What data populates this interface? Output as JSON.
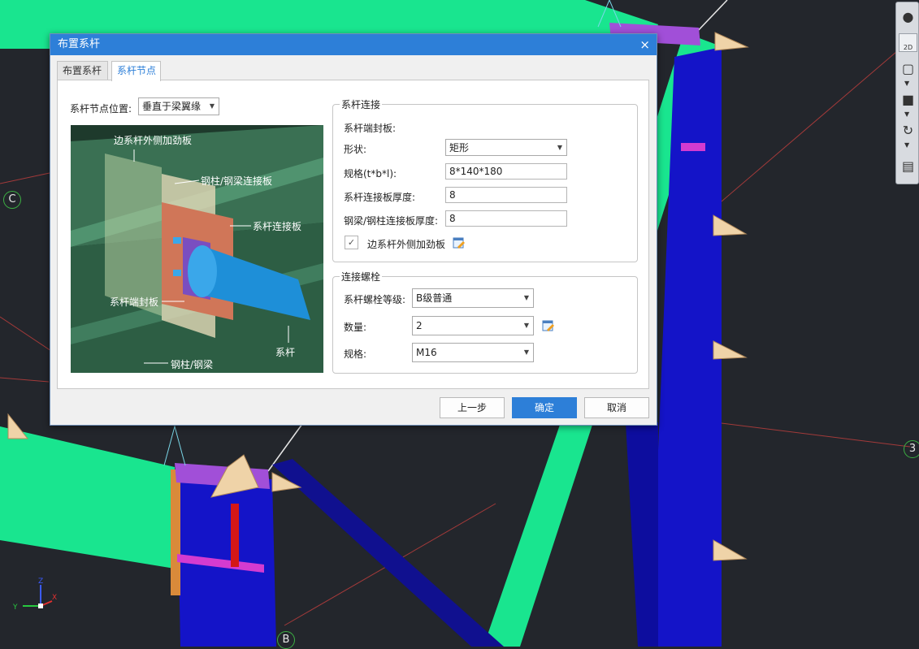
{
  "viewport": {
    "axis_labels": [
      "C",
      "3",
      "B"
    ],
    "viewbar": {
      "mode_2d_label": "2D"
    },
    "triad": {
      "x": "X",
      "y": "Y",
      "z": "Z"
    }
  },
  "dialog": {
    "title": "布置系杆",
    "close_glyph": "×",
    "tabs": [
      {
        "label": "布置系杆",
        "active": false
      },
      {
        "label": "系杆节点",
        "active": true
      }
    ],
    "node_position": {
      "label": "系杆节点位置:",
      "value": "垂直于梁翼缘"
    },
    "preview": {
      "callouts": [
        "边系杆外侧加劲板",
        "钢柱/钢梁连接板",
        "系杆连接板",
        "系杆端封板",
        "系杆",
        "钢柱/钢梁"
      ]
    },
    "tie_connection": {
      "title": "系杆连接",
      "end_plate_label": "系杆端封板:",
      "shape": {
        "label": "形状:",
        "value": "矩形"
      },
      "spec": {
        "label": "规格(t*b*l):",
        "value": "8*140*180"
      },
      "tie_plate_thickness": {
        "label": "系杆连接板厚度:",
        "value": "8"
      },
      "beam_plate_thickness": {
        "label": "钢梁/钢柱连接板厚度:",
        "value": "8"
      },
      "stiffener": {
        "label": "边系杆外侧加劲板",
        "checked": true,
        "check_glyph": "✓"
      }
    },
    "bolts": {
      "title": "连接螺栓",
      "grade": {
        "label": "系杆螺栓等级:",
        "value": "B级普通"
      },
      "count": {
        "label": "数量:",
        "value": "2"
      },
      "spec": {
        "label": "规格:",
        "value": "M16"
      }
    },
    "buttons": {
      "prev": "上一步",
      "ok": "确定",
      "cancel": "取消"
    }
  },
  "colors": {
    "title_bar": "#2d7fd8",
    "beam_green": "#19e58f",
    "column_blue": "#1414c8",
    "viewport_bg": "#23262c"
  }
}
